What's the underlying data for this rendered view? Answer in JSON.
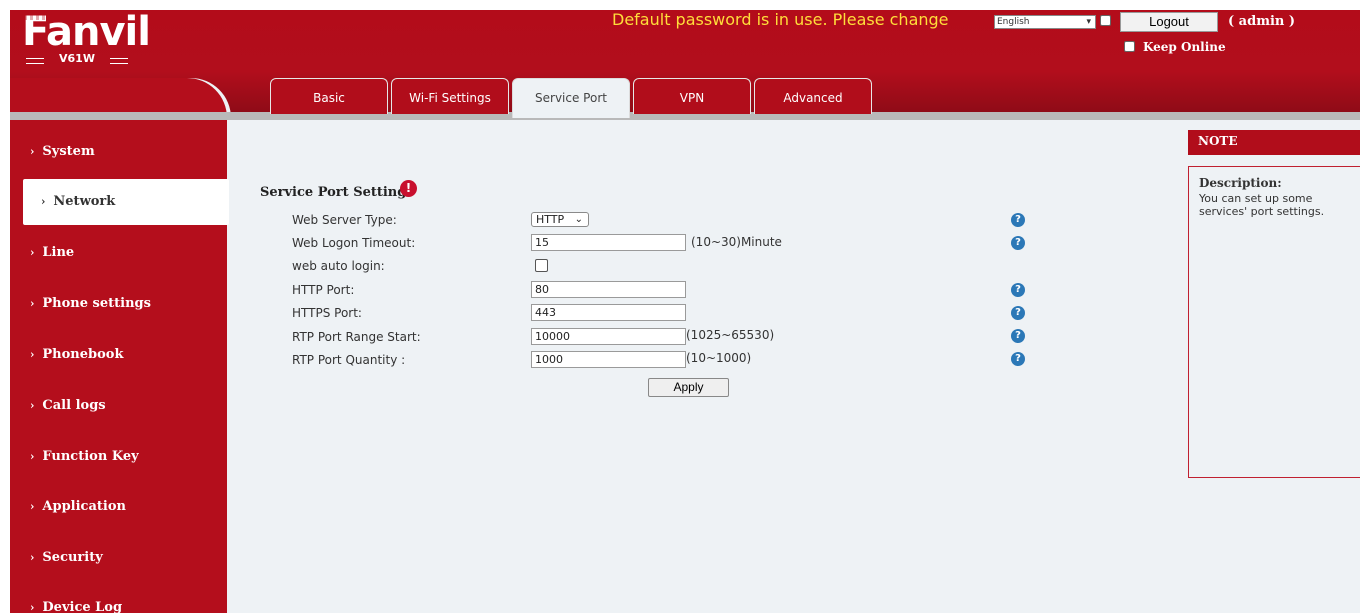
{
  "header": {
    "logo_text": "Fanvil",
    "model": "V61W",
    "warning": "Default password is in use. Please change",
    "language": "English",
    "logout_label": "Logout",
    "user": "( admin )",
    "keep_online_label": "Keep Online"
  },
  "tabs": [
    {
      "label": "Basic"
    },
    {
      "label": "Wi-Fi Settings"
    },
    {
      "label": "Service Port"
    },
    {
      "label": "VPN"
    },
    {
      "label": "Advanced"
    }
  ],
  "sidebar": {
    "items": [
      {
        "label": "System"
      },
      {
        "label": "Network"
      },
      {
        "label": "Line"
      },
      {
        "label": "Phone settings"
      },
      {
        "label": "Phonebook"
      },
      {
        "label": "Call logs"
      },
      {
        "label": "Function Key"
      },
      {
        "label": "Application"
      },
      {
        "label": "Security"
      },
      {
        "label": "Device Log"
      }
    ]
  },
  "form": {
    "title": "Service Port Settings",
    "web_server_type": {
      "label": "Web Server Type:",
      "value": "HTTP"
    },
    "web_logon_timeout": {
      "label": "Web Logon Timeout:",
      "value": "15",
      "unit": "(10~30)Minute"
    },
    "web_auto_login": {
      "label": "web auto login:"
    },
    "http_port": {
      "label": "HTTP Port:",
      "value": "80"
    },
    "https_port": {
      "label": "HTTPS Port:",
      "value": "443"
    },
    "rtp_port_start": {
      "label": "RTP Port Range Start:",
      "value": "10000",
      "unit": "(1025~65530)"
    },
    "rtp_port_quantity": {
      "label": "RTP Port Quantity :",
      "value": "1000",
      "unit": "(10~1000)"
    },
    "apply_label": "Apply"
  },
  "note": {
    "title": "NOTE",
    "desc_title": "Description:",
    "desc_text": "You can set up some services' port settings."
  },
  "colors": {
    "brand_red": "#b10d1b",
    "warning_yellow": "#ffde3a",
    "help_blue": "#2b78b7",
    "content_bg": "#eef2f5"
  }
}
